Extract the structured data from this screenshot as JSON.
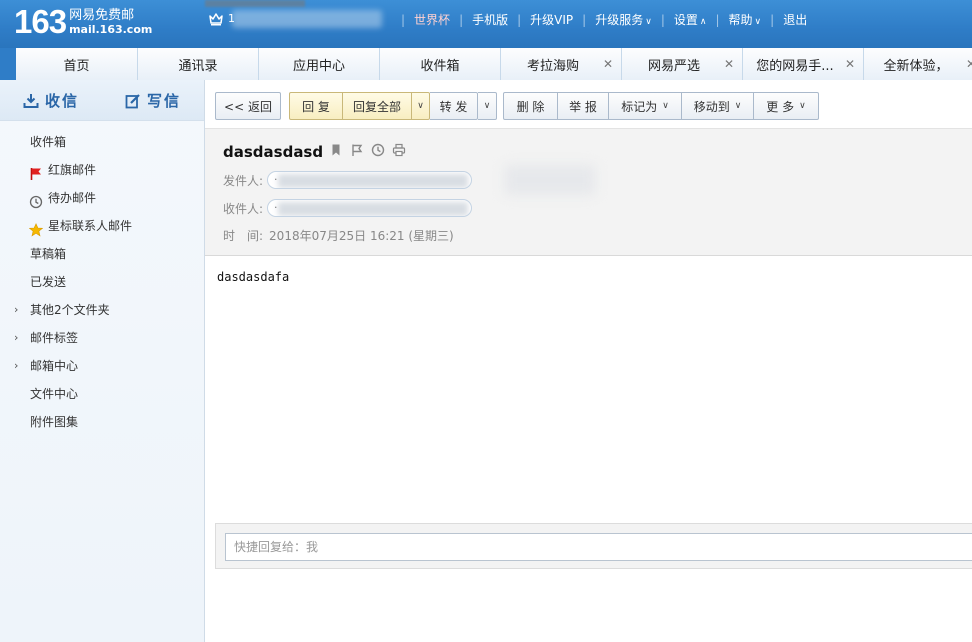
{
  "header": {
    "logo_num": "163",
    "logo_cn": "网易免费邮",
    "logo_domain": "mail.163.com",
    "user_initial": "1",
    "nav": [
      {
        "label": "世界杯",
        "highlight": true,
        "caret": ""
      },
      {
        "label": "手机版",
        "highlight": false,
        "caret": ""
      },
      {
        "label": "升级VIP",
        "highlight": false,
        "caret": ""
      },
      {
        "label": "升级服务",
        "highlight": false,
        "caret": "∨"
      },
      {
        "label": "设置",
        "highlight": false,
        "caret": "∧"
      },
      {
        "label": "帮助",
        "highlight": false,
        "caret": "∨"
      },
      {
        "label": "退出",
        "highlight": false,
        "caret": ""
      }
    ]
  },
  "tabs": [
    {
      "label": "首页",
      "closable": false
    },
    {
      "label": "通讯录",
      "closable": false
    },
    {
      "label": "应用中心",
      "closable": false
    },
    {
      "label": "收件箱",
      "closable": false
    },
    {
      "label": "考拉海购",
      "closable": true
    },
    {
      "label": "网易严选",
      "closable": true
    },
    {
      "label": "您的网易手...",
      "closable": true
    },
    {
      "label": "全新体验，",
      "closable": true
    }
  ],
  "sidebar": {
    "receive_label": "收信",
    "compose_label": "写信",
    "folders": [
      {
        "label": "收件箱",
        "icon": "",
        "arrow": false
      },
      {
        "label": "红旗邮件",
        "icon": "red-flag-icon",
        "arrow": false
      },
      {
        "label": "待办邮件",
        "icon": "clock-icon",
        "arrow": false
      },
      {
        "label": "星标联系人邮件",
        "icon": "star-icon",
        "arrow": false
      },
      {
        "label": "草稿箱",
        "icon": "",
        "arrow": false
      },
      {
        "label": "已发送",
        "icon": "",
        "arrow": false
      },
      {
        "label": "其他2个文件夹",
        "icon": "",
        "arrow": true
      },
      {
        "label": "邮件标签",
        "icon": "",
        "arrow": true
      },
      {
        "label": "邮箱中心",
        "icon": "",
        "arrow": true
      },
      {
        "label": "文件中心",
        "icon": "",
        "arrow": false
      },
      {
        "label": "附件图集",
        "icon": "",
        "arrow": false
      }
    ]
  },
  "toolbar": {
    "back_label": "<< 返回",
    "reply_label": "回 复",
    "reply_all_label": "回复全部",
    "forward_label": "转 发",
    "delete_label": "删 除",
    "report_label": "举 报",
    "mark_label": "标记为",
    "move_label": "移动到",
    "more_label": "更 多"
  },
  "mail": {
    "subject": "dasdasdasd",
    "from_label": "发件人:",
    "to_label": "收件人:",
    "time_label": "时　间:",
    "time_value": "2018年07月25日 16:21 (星期三)",
    "body": "dasdasdafa"
  },
  "quick_reply": {
    "placeholder": "快捷回复给：我"
  },
  "colors": {
    "header_blue": "#2f7dc7",
    "link_blue": "#2a66a7",
    "flag_red": "#e02020",
    "star_yellow": "#f5b800"
  }
}
